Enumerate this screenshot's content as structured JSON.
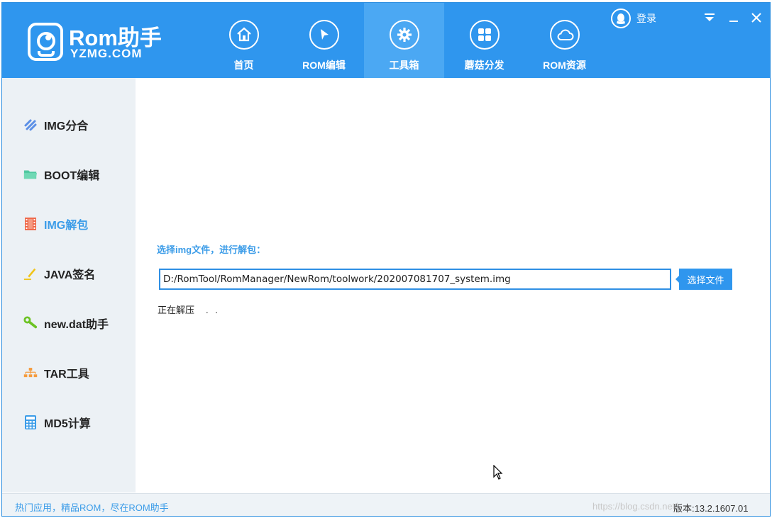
{
  "app": {
    "logo_title": "Rom助手",
    "logo_subtitle": "YZMG.COM"
  },
  "nav": {
    "items": [
      {
        "label": "首页",
        "icon": "home-icon"
      },
      {
        "label": "ROM编辑",
        "icon": "cursor-arrow-icon"
      },
      {
        "label": "工具箱",
        "icon": "gear-icon",
        "active": true
      },
      {
        "label": "蘑菇分发",
        "icon": "grid-apps-icon"
      },
      {
        "label": "ROM资源",
        "icon": "cloud-icon"
      }
    ],
    "login_label": "登录"
  },
  "sidebar": {
    "items": [
      {
        "label": "IMG分合",
        "icon": "split-merge-icon",
        "color": "#5b8fe6"
      },
      {
        "label": "BOOT编辑",
        "icon": "folder-icon",
        "color": "#4fc8a0"
      },
      {
        "label": "IMG解包",
        "icon": "film-icon",
        "color": "#ef6a4b",
        "active": true
      },
      {
        "label": "JAVA签名",
        "icon": "pen-icon",
        "color": "#f0c419"
      },
      {
        "label": "new.dat助手",
        "icon": "wrench-icon",
        "color": "#6cc324"
      },
      {
        "label": "TAR工具",
        "icon": "hierarchy-icon",
        "color": "#f59b3c"
      },
      {
        "label": "MD5计算",
        "icon": "calculator-icon",
        "color": "#3b9ce8"
      }
    ]
  },
  "main": {
    "prompt": "选择img文件，进行解包：",
    "file_path": "D:/RomTool/RomManager/NewRom/toolwork/202007081707_system.img",
    "choose_button": "选择文件",
    "status_text": "正在解压",
    "status_dots": ". ."
  },
  "footer": {
    "slogan": "热门应用，精品ROM，尽在ROM助手",
    "watermark": "https://blog.csdn.net/...",
    "version": "版本:13.2.1607.01"
  },
  "colors": {
    "header_bg": "#2f96ee",
    "active_nav_bg": "#4ba8f3",
    "accent": "#3b9ce8",
    "sidebar_bg": "#ecf1f5"
  }
}
